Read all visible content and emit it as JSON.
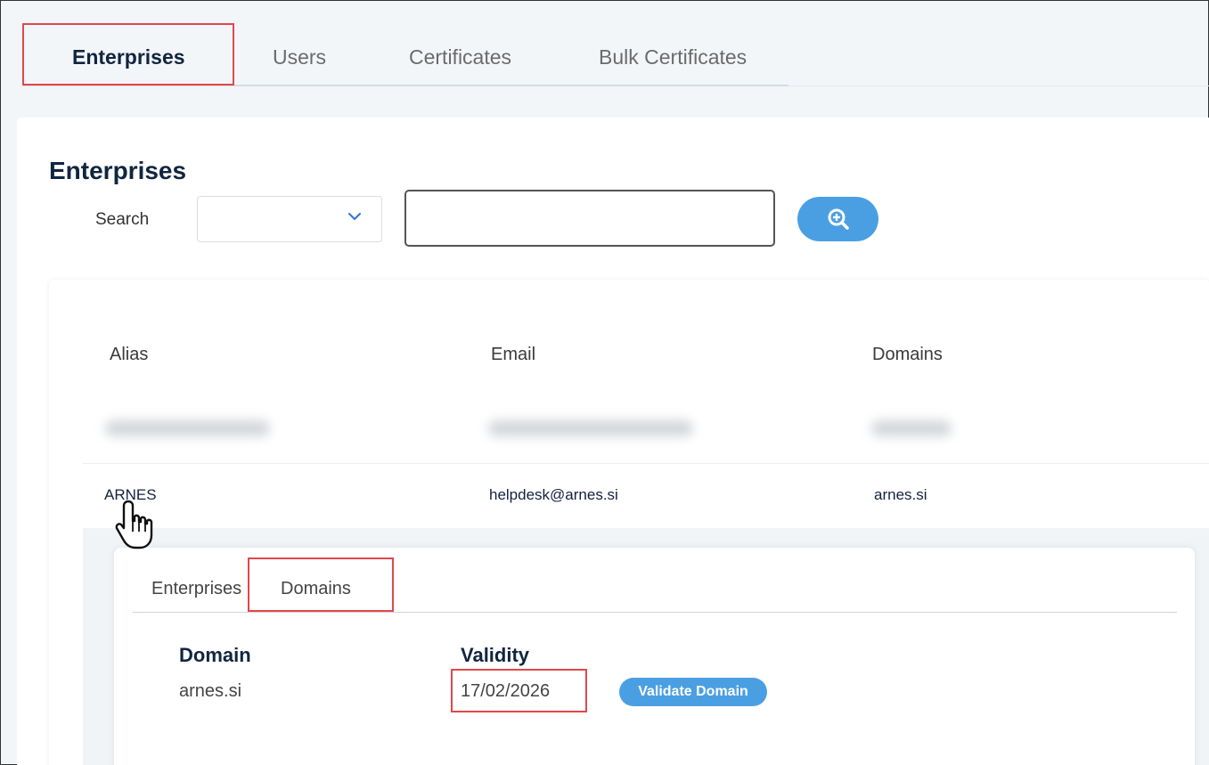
{
  "top_tabs": {
    "enterprises": "Enterprises",
    "users": "Users",
    "certificates": "Certificates",
    "bulk_certificates": "Bulk Certificates"
  },
  "page": {
    "title": "Enterprises",
    "search_label": "Search",
    "search_select_value": "",
    "search_input_value": ""
  },
  "table": {
    "headers": {
      "alias": "Alias",
      "email": "Email",
      "domains": "Domains"
    },
    "row": {
      "alias": "ARNES",
      "email": "helpdesk@arnes.si",
      "domains": "arnes.si"
    }
  },
  "detail": {
    "tabs": {
      "enterprises": "Enterprises",
      "domains": "Domains"
    },
    "headers": {
      "domain": "Domain",
      "validity": "Validity"
    },
    "row": {
      "domain": "arnes.si",
      "validity": "17/02/2026"
    },
    "validate_label": "Validate Domain"
  },
  "icons": {
    "select_chevron": "chevron-down-icon",
    "search_button": "zoom-in-icon",
    "cursor": "hand-pointer-icon"
  },
  "colors": {
    "accent": "#4a9fe3",
    "title": "#10253f",
    "highlight_border": "#e2474b"
  }
}
